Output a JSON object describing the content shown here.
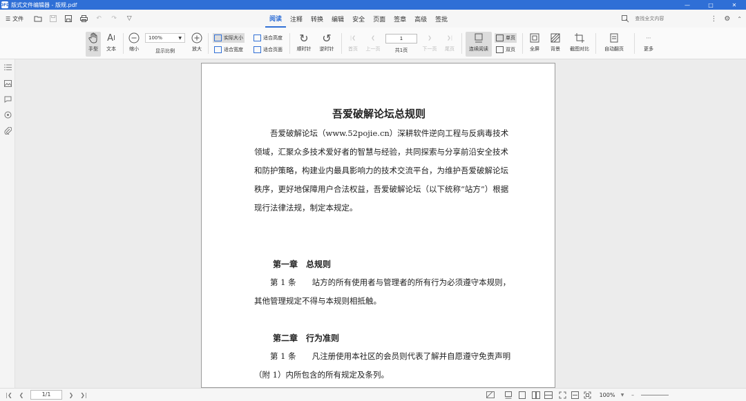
{
  "titlebar": {
    "app_icon": "OFD",
    "title": "版式文件编辑器 - 版规.pdf"
  },
  "menubar": {
    "file_label": "文件",
    "tabs": [
      "阅读",
      "注释",
      "转换",
      "编辑",
      "安全",
      "页面",
      "签章",
      "高级",
      "签批"
    ],
    "active_tab": "阅读",
    "search_placeholder": "查找全文内容"
  },
  "toolbar": {
    "hand_label": "手型",
    "text_label": "文本",
    "zoom_out_label": "缩小",
    "zoom_value": "100%",
    "zoom_display_label": "显示比例",
    "zoom_in_label": "放大",
    "actual_size_label": "实际大小",
    "fit_width_label": "适合宽度",
    "fit_height_label": "适合高度",
    "fit_page_label": "适合页面",
    "rotate_cw_label": "顺时针",
    "rotate_ccw_label": "逆时针",
    "first_page_label": "首页",
    "prev_page_label": "上一页",
    "page_value": "1",
    "total_pages_label": "共1页",
    "next_page_label": "下一页",
    "last_page_label": "尾页",
    "continuous_label": "连续阅读",
    "single_page_label": "单页",
    "double_page_label": "双页",
    "fullscreen_label": "全屏",
    "background_label": "背景",
    "screenshot_compare_label": "截图对比",
    "auto_flip_label": "自动翻页",
    "more_label": "更多"
  },
  "document": {
    "title": "吾爱破解论坛总规则",
    "intro": "吾爱破解论坛（www.52pojie.cn）深耕软件逆向工程与反病毒技术领域，汇聚众多技术爱好者的智慧与经验，共同探索与分享前沿安全技术和防护策略，构建业内最具影响力的技术交流平台，为维护吾爱破解论坛秩序，更好地保障用户合法权益，吾爱破解论坛（以下统称“站方”）根据现行法律法规，制定本规定。",
    "chapter1_title": "第一章　总规则",
    "chapter1_article": "第 1 条　　站方的所有使用者与管理者的所有行为必须遵守本规则，其他管理规定不得与本规则相抵触。",
    "chapter2_title": "第二章　行为准则",
    "chapter2_article": "第 1 条　　凡注册使用本社区的会员则代表了解并自愿遵守免责声明（附 1）内所包含的所有规定及条列。"
  },
  "statusbar": {
    "page_value": "1/1",
    "zoom_value": "100%"
  }
}
